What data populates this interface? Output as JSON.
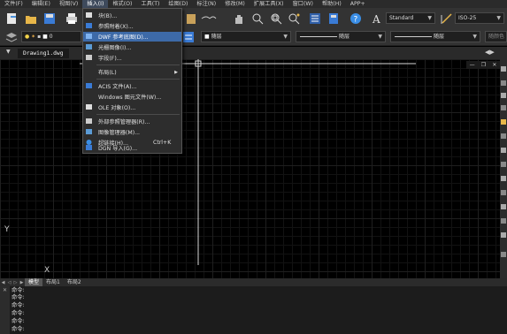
{
  "menubar": {
    "items": [
      "文件(F)",
      "编辑(E)",
      "视图(V)",
      "插入(I)",
      "格式(O)",
      "工具(T)",
      "绘图(D)",
      "标注(N)",
      "修改(M)",
      "扩展工具(X)",
      "窗口(W)",
      "帮助(H)",
      "APP+"
    ],
    "active_index": 3
  },
  "toolbar": {
    "text_style": "Standard",
    "dim_style": "ISO-25",
    "layer_value": "0",
    "color_value": "随层",
    "linetype_value": "随层",
    "lineweight_value": "随层",
    "plotstyle_value": "随颜色"
  },
  "document": {
    "tab_title": "Drawing1.dwg"
  },
  "insert_menu": {
    "items": [
      {
        "label": "块(B)...",
        "shortcut": "",
        "icon": "block-icon"
      },
      {
        "label": "参照附着(X)...",
        "shortcut": "",
        "icon": "xref-icon"
      },
      {
        "label": "DWF 参考底图(D)...",
        "shortcut": "",
        "icon": "dwf-icon",
        "highlighted": true
      },
      {
        "label": "光栅图像(I)...",
        "shortcut": "",
        "icon": "raster-image-icon"
      },
      {
        "label": "字段(F)...",
        "shortcut": "",
        "icon": "field-icon"
      },
      {
        "label": "布局(L)",
        "shortcut": "",
        "icon": "",
        "submenu": true
      },
      {
        "label": "ACIS 文件(A)...",
        "shortcut": "",
        "icon": "acis-icon"
      },
      {
        "label": "Windows 图元文件(W)...",
        "shortcut": "",
        "icon": ""
      },
      {
        "label": "OLE 对象(O)...",
        "shortcut": "",
        "icon": "ole-icon"
      },
      {
        "label": "外部参照管理器(R)...",
        "shortcut": "",
        "icon": "xref-manager-icon"
      },
      {
        "label": "图像管理器(M)...",
        "shortcut": "",
        "icon": "image-manager-icon"
      },
      {
        "label": "超链接(H)...",
        "shortcut": "Ctrl+K",
        "icon": "hyperlink-icon"
      },
      {
        "label": "DGN 导入(G)...",
        "shortcut": "",
        "icon": "dgn-icon"
      }
    ]
  },
  "ucs": {
    "x_label": "X",
    "y_label": "Y"
  },
  "layout_tabs": {
    "items": [
      "模型",
      "布局1",
      "布局2"
    ],
    "active_index": 0
  },
  "command": {
    "lines": [
      "命令:",
      "命令:",
      "命令:",
      "命令:",
      "命令:",
      "命令:"
    ]
  },
  "colors": {
    "accent": "#3d6aa8",
    "background": "#000000",
    "panel": "#333333"
  }
}
